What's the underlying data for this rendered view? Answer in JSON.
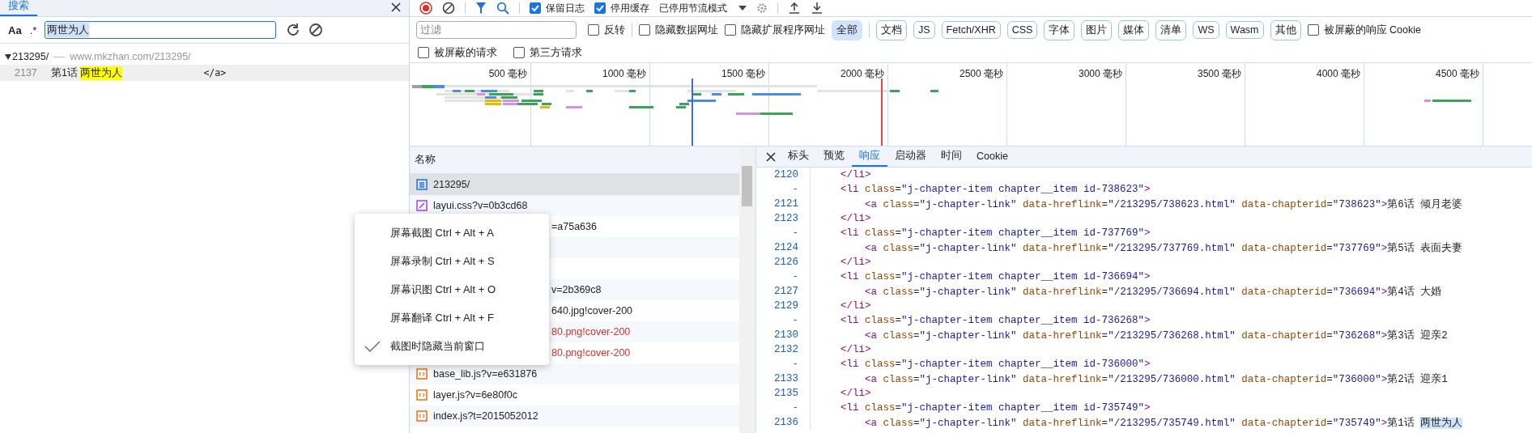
{
  "search_panel": {
    "tab": {
      "label": "搜索",
      "selected": true
    },
    "options": [
      "Aa",
      ".*"
    ],
    "query": "两世为人",
    "results": [
      {
        "file": "213295/",
        "url": "www.mkzhan.com/213295/",
        "expanded": true,
        "matches": [
          {
            "line": "2137",
            "before": "第1话 ",
            "match": "两世为人",
            "after": "</a>"
          }
        ]
      }
    ]
  },
  "network": {
    "toolbar": {
      "preserve_log": {
        "label": "保留日志",
        "checked": true
      },
      "disable_cache": {
        "label": "停用缓存",
        "checked": true
      },
      "throttling": "已停用节流模式"
    },
    "filter": {
      "placeholder": "过滤",
      "invert": {
        "label": "反转",
        "checked": false
      },
      "hide_data_urls": {
        "label": "隐藏数据网址",
        "checked": false
      },
      "hide_extension_urls": {
        "label": "隐藏扩展程序网址",
        "checked": false
      },
      "types": [
        {
          "label": "全部",
          "selected": true
        },
        {
          "label": "文档",
          "selected": false
        },
        {
          "label": "JS",
          "selected": false
        },
        {
          "label": "Fetch/XHR",
          "selected": false
        },
        {
          "label": "CSS",
          "selected": false
        },
        {
          "label": "字体",
          "selected": false
        },
        {
          "label": "图片",
          "selected": false
        },
        {
          "label": "媒体",
          "selected": false
        },
        {
          "label": "清单",
          "selected": false
        },
        {
          "label": "WS",
          "selected": false
        },
        {
          "label": "Wasm",
          "selected": false
        },
        {
          "label": "其他",
          "selected": false
        }
      ],
      "blocked_cookies": {
        "label": "被屏蔽的响应 Cookie",
        "checked": false
      },
      "blocked_requests": {
        "label": "被屏蔽的请求",
        "checked": false
      },
      "third_party": {
        "label": "第三方请求",
        "checked": false
      }
    },
    "timeline": {
      "ticks": [
        "500 毫秒",
        "1000 毫秒",
        "1500 毫秒",
        "2000 毫秒",
        "2500 毫秒",
        "3000 毫秒",
        "3500 毫秒",
        "4000 毫秒",
        "4500 毫秒"
      ]
    },
    "requests": {
      "column": "名称",
      "rows": [
        {
          "kind": "document",
          "name": "213295/",
          "selected": true,
          "failed": false
        },
        {
          "kind": "stylesheet",
          "name": "layui.css?v=0b3cd68",
          "selected": false,
          "failed": false
        },
        {
          "kind": "covered",
          "name": "=a75a636",
          "selected": false,
          "failed": false
        },
        {
          "kind": "covered",
          "selected": false
        },
        {
          "kind": "covered",
          "selected": false
        },
        {
          "kind": "covered",
          "name": "v=2b369c8",
          "selected": false,
          "failed": false
        },
        {
          "kind": "covered",
          "name": "640.jpg!cover-200",
          "selected": false,
          "failed": false
        },
        {
          "kind": "covered",
          "name": "80.png!cover-200",
          "selected": false,
          "failed": true
        },
        {
          "kind": "covered",
          "name": "80.png!cover-200",
          "selected": false,
          "failed": true
        },
        {
          "kind": "script",
          "name": "base_lib.js?v=e631876",
          "selected": false,
          "failed": false
        },
        {
          "kind": "script",
          "name": "layer.js?v=6e80f0c",
          "selected": false,
          "failed": false
        },
        {
          "kind": "script",
          "name": "index.js?t=2015052012",
          "selected": false,
          "failed": false
        }
      ]
    },
    "details": {
      "tabs": [
        {
          "label": "标头",
          "selected": false
        },
        {
          "label": "预览",
          "selected": false
        },
        {
          "label": "响应",
          "selected": true
        },
        {
          "label": "启动器",
          "selected": false
        },
        {
          "label": "时间",
          "selected": false
        },
        {
          "label": "Cookie",
          "selected": false
        }
      ],
      "lines": [
        {
          "n": "2120",
          "c": [
            {
              "kind": "tag",
              "text": "    </li>"
            }
          ]
        },
        {
          "n": "-",
          "c": [
            {
              "kind": "tag",
              "text": "    <li"
            },
            {
              "kind": "attr",
              "text": " class"
            },
            {
              "kind": "plain",
              "text": "="
            },
            {
              "kind": "value",
              "text": "\"j-chapter-item chapter__item id-738623\""
            },
            {
              "kind": "tag",
              "text": ">"
            }
          ]
        },
        {
          "n": "2121",
          "c": [
            {
              "kind": "tag",
              "text": "        <a"
            },
            {
              "kind": "attr",
              "text": " class"
            },
            {
              "kind": "plain",
              "text": "="
            },
            {
              "kind": "value",
              "text": "\"j-chapter-link\""
            },
            {
              "kind": "attr",
              "text": " data-hreflink"
            },
            {
              "kind": "plain",
              "text": "="
            },
            {
              "kind": "value",
              "text": "\"/213295/738623.html\""
            },
            {
              "kind": "attr",
              "text": " data-chapterid"
            },
            {
              "kind": "plain",
              "text": "="
            },
            {
              "kind": "value",
              "text": "\"738623\""
            },
            {
              "kind": "tag",
              "text": ">"
            },
            {
              "kind": "plain",
              "text": "第6话 倾月老婆"
            }
          ]
        },
        {
          "n": "2123",
          "c": [
            {
              "kind": "tag",
              "text": "    </li>"
            }
          ]
        },
        {
          "n": "-",
          "c": [
            {
              "kind": "tag",
              "text": "    <li"
            },
            {
              "kind": "attr",
              "text": " class"
            },
            {
              "kind": "plain",
              "text": "="
            },
            {
              "kind": "value",
              "text": "\"j-chapter-item chapter__item id-737769\""
            },
            {
              "kind": "tag",
              "text": ">"
            }
          ]
        },
        {
          "n": "2124",
          "c": [
            {
              "kind": "tag",
              "text": "        <a"
            },
            {
              "kind": "attr",
              "text": " class"
            },
            {
              "kind": "plain",
              "text": "="
            },
            {
              "kind": "value",
              "text": "\"j-chapter-link\""
            },
            {
              "kind": "attr",
              "text": " data-hreflink"
            },
            {
              "kind": "plain",
              "text": "="
            },
            {
              "kind": "value",
              "text": "\"/213295/737769.html\""
            },
            {
              "kind": "attr",
              "text": " data-chapterid"
            },
            {
              "kind": "plain",
              "text": "="
            },
            {
              "kind": "value",
              "text": "\"737769\""
            },
            {
              "kind": "tag",
              "text": ">"
            },
            {
              "kind": "plain",
              "text": "第5话 表面夫妻"
            }
          ]
        },
        {
          "n": "2126",
          "c": [
            {
              "kind": "tag",
              "text": "    </li>"
            }
          ]
        },
        {
          "n": "-",
          "c": [
            {
              "kind": "tag",
              "text": "    <li"
            },
            {
              "kind": "attr",
              "text": " class"
            },
            {
              "kind": "plain",
              "text": "="
            },
            {
              "kind": "value",
              "text": "\"j-chapter-item chapter__item id-736694\""
            },
            {
              "kind": "tag",
              "text": ">"
            }
          ]
        },
        {
          "n": "2127",
          "c": [
            {
              "kind": "tag",
              "text": "        <a"
            },
            {
              "kind": "attr",
              "text": " class"
            },
            {
              "kind": "plain",
              "text": "="
            },
            {
              "kind": "value",
              "text": "\"j-chapter-link\""
            },
            {
              "kind": "attr",
              "text": " data-hreflink"
            },
            {
              "kind": "plain",
              "text": "="
            },
            {
              "kind": "value",
              "text": "\"/213295/736694.html\""
            },
            {
              "kind": "attr",
              "text": " data-chapterid"
            },
            {
              "kind": "plain",
              "text": "="
            },
            {
              "kind": "value",
              "text": "\"736694\""
            },
            {
              "kind": "tag",
              "text": ">"
            },
            {
              "kind": "plain",
              "text": "第4话 大婚"
            }
          ]
        },
        {
          "n": "2129",
          "c": [
            {
              "kind": "tag",
              "text": "    </li>"
            }
          ]
        },
        {
          "n": "-",
          "c": [
            {
              "kind": "tag",
              "text": "    <li"
            },
            {
              "kind": "attr",
              "text": " class"
            },
            {
              "kind": "plain",
              "text": "="
            },
            {
              "kind": "value",
              "text": "\"j-chapter-item chapter__item id-736268\""
            },
            {
              "kind": "tag",
              "text": ">"
            }
          ]
        },
        {
          "n": "2130",
          "c": [
            {
              "kind": "tag",
              "text": "        <a"
            },
            {
              "kind": "attr",
              "text": " class"
            },
            {
              "kind": "plain",
              "text": "="
            },
            {
              "kind": "value",
              "text": "\"j-chapter-link\""
            },
            {
              "kind": "attr",
              "text": " data-hreflink"
            },
            {
              "kind": "plain",
              "text": "="
            },
            {
              "kind": "value",
              "text": "\"/213295/736268.html\""
            },
            {
              "kind": "attr",
              "text": " data-chapterid"
            },
            {
              "kind": "plain",
              "text": "="
            },
            {
              "kind": "value",
              "text": "\"736268\""
            },
            {
              "kind": "tag",
              "text": ">"
            },
            {
              "kind": "plain",
              "text": "第3话 迎亲2"
            }
          ]
        },
        {
          "n": "2132",
          "c": [
            {
              "kind": "tag",
              "text": "    </li>"
            }
          ]
        },
        {
          "n": "-",
          "c": [
            {
              "kind": "tag",
              "text": "    <li"
            },
            {
              "kind": "attr",
              "text": " class"
            },
            {
              "kind": "plain",
              "text": "="
            },
            {
              "kind": "value",
              "text": "\"j-chapter-item chapter__item id-736000\""
            },
            {
              "kind": "tag",
              "text": ">"
            }
          ]
        },
        {
          "n": "2133",
          "c": [
            {
              "kind": "tag",
              "text": "        <a"
            },
            {
              "kind": "attr",
              "text": " class"
            },
            {
              "kind": "plain",
              "text": "="
            },
            {
              "kind": "value",
              "text": "\"j-chapter-link\""
            },
            {
              "kind": "attr",
              "text": " data-hreflink"
            },
            {
              "kind": "plain",
              "text": "="
            },
            {
              "kind": "value",
              "text": "\"/213295/736000.html\""
            },
            {
              "kind": "attr",
              "text": " data-chapterid"
            },
            {
              "kind": "plain",
              "text": "="
            },
            {
              "kind": "value",
              "text": "\"736000\""
            },
            {
              "kind": "tag",
              "text": ">"
            },
            {
              "kind": "plain",
              "text": "第2话 迎亲1"
            }
          ]
        },
        {
          "n": "2135",
          "c": [
            {
              "kind": "tag",
              "text": "    </li>"
            }
          ]
        },
        {
          "n": "-",
          "c": [
            {
              "kind": "tag",
              "text": "    <li"
            },
            {
              "kind": "attr",
              "text": " class"
            },
            {
              "kind": "plain",
              "text": "="
            },
            {
              "kind": "value",
              "text": "\"j-chapter-item chapter__item id-735749\""
            },
            {
              "kind": "tag",
              "text": ">"
            }
          ]
        },
        {
          "n": "2136",
          "c": [
            {
              "kind": "tag",
              "text": "        <a"
            },
            {
              "kind": "attr",
              "text": " class"
            },
            {
              "kind": "plain",
              "text": "="
            },
            {
              "kind": "value",
              "text": "\"j-chapter-link\""
            },
            {
              "kind": "attr",
              "text": " data-hreflink"
            },
            {
              "kind": "plain",
              "text": "="
            },
            {
              "kind": "value",
              "text": "\"/213295/735749.html\""
            },
            {
              "kind": "attr",
              "text": " data-chapterid"
            },
            {
              "kind": "plain",
              "text": "="
            },
            {
              "kind": "value",
              "text": "\"735749\""
            },
            {
              "kind": "tag",
              "text": ">"
            },
            {
              "kind": "plain",
              "text": "第1话 "
            },
            {
              "kind": "highlight",
              "text": "两世为人"
            }
          ]
        }
      ]
    }
  },
  "context_menu": {
    "items": [
      {
        "label": "屏幕截图 Ctrl + Alt + A",
        "checked": false
      },
      {
        "label": "屏幕录制 Ctrl + Alt + S",
        "checked": false
      },
      {
        "label": "屏幕识图 Ctrl + Alt + O",
        "checked": false
      },
      {
        "label": "屏幕翻译 Ctrl + Alt + F",
        "checked": false
      },
      {
        "label": "截图时隐藏当前窗口",
        "checked": true
      }
    ]
  }
}
